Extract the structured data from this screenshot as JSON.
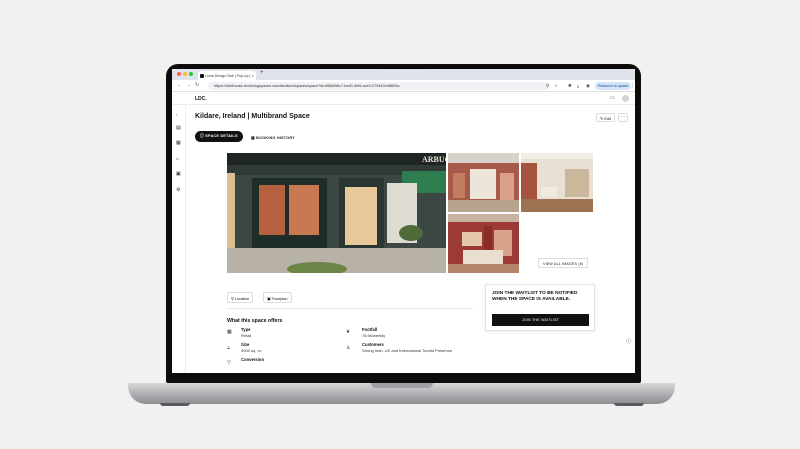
{
  "browser": {
    "tab_title": "Luma Design Club | Pop-Up (",
    "tab_close": "×",
    "new_tab": "+",
    "url": "https://clubhouse.revelvingspaces.com/landlord/spaces/space?id=8f88496c7-bcd0-4bf9-ace3-079442e4f8f25a",
    "relaunch_label": "Relaunch to update",
    "icons": [
      "back-arrow-icon",
      "forward-arrow-icon",
      "reload-icon",
      "site-info-icon",
      "extensions-icon",
      "bookmark-icon",
      "download-icon",
      "profile-icon",
      "menu-icon"
    ]
  },
  "app": {
    "logo": "LDC.",
    "colors": {
      "accent": "#111111",
      "border": "#dddddd"
    }
  },
  "space": {
    "title": "Kildare, Ireland | Multibrand Space",
    "edit_label": "Edit",
    "more_label": "···"
  },
  "tabs": [
    {
      "label": "SPACE DETAILS",
      "active": true
    },
    {
      "label": "BOOKING HISTORY",
      "active": false
    }
  ],
  "gallery": {
    "view_all_label": "VIEW ALL IMAGES (6)",
    "storefront_sign": "ARBUC"
  },
  "chips": {
    "location": "Location",
    "floorplan": "Floorplan"
  },
  "waitlist": {
    "text": "JOIN THE WAITLIST TO BE NOTIFIED WHEN THE SPACE IS AVAILABLE.",
    "button": "JOIN THE WAITLIST"
  },
  "offers": {
    "title": "What this space offers",
    "items": [
      {
        "label": "Type",
        "value": "Retail",
        "icon": "store-icon"
      },
      {
        "label": "Footfall",
        "value": "78.9k/weekly",
        "icon": "footsteps-icon"
      },
      {
        "label": "Size",
        "value": "3000 sq. m.",
        "icon": "ruler-icon"
      },
      {
        "label": "Customers",
        "value": "Strong Irish, UK and International Tourist Presence",
        "icon": "user-icon"
      },
      {
        "label": "Conversion",
        "value": "",
        "icon": "funnel-icon"
      }
    ]
  }
}
